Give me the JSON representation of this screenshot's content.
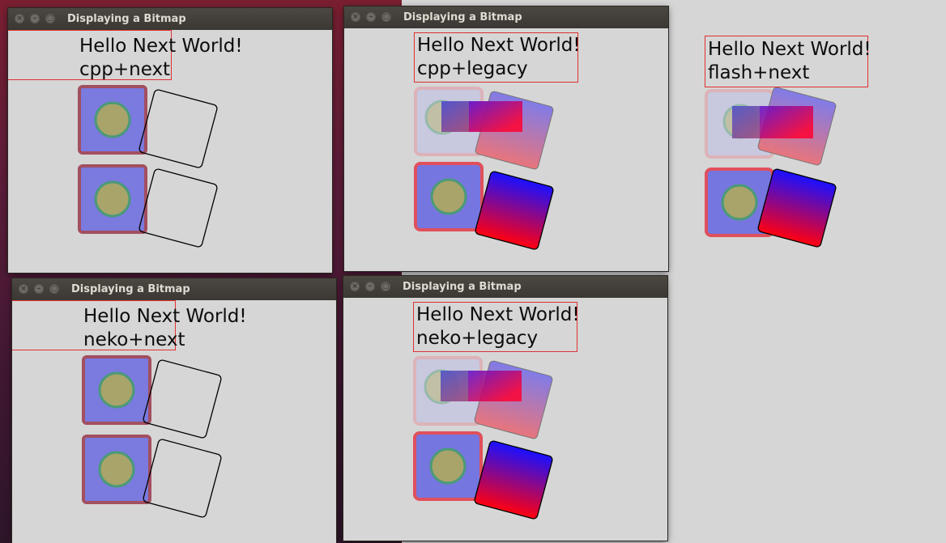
{
  "windows": [
    {
      "id": "cpp-next",
      "title": "Displaying a Bitmap",
      "line1": "Hello Next World!",
      "line2": "cpp+next"
    },
    {
      "id": "cpp-legacy",
      "title": "Displaying a Bitmap",
      "line1": "Hello Next World!",
      "line2": "cpp+legacy"
    },
    {
      "id": "flash-next",
      "title": "",
      "line1": "Hello Next World!",
      "line2": "flash+next"
    },
    {
      "id": "neko-next",
      "title": "Displaying a Bitmap",
      "line1": "Hello Next World!",
      "line2": "neko+next"
    },
    {
      "id": "neko-legacy",
      "title": "Displaying a Bitmap",
      "line1": "Hello Next World!",
      "line2": "neko+legacy"
    }
  ],
  "icons": {
    "close": "close-icon",
    "minimize": "minimize-icon",
    "maximize": "maximize-icon"
  },
  "colors": {
    "text_border": "#e03030",
    "square_fill": "#7676e0",
    "circle_fill": "#a8a46a",
    "circle_stroke": "#4a9a78",
    "gradient_top": "#1a10ff",
    "gradient_bottom": "#ff0010"
  }
}
